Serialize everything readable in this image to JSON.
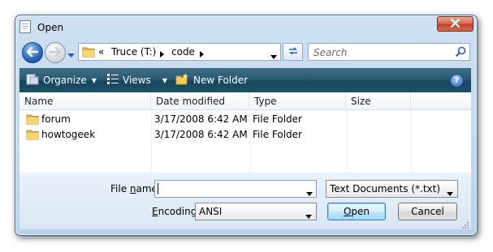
{
  "window": {
    "title": "Open",
    "icon": "open-dialog-icon",
    "close_icon": "close-icon"
  },
  "navigation": {
    "back_icon": "back-arrow-icon",
    "forward_icon": "forward-arrow-icon",
    "history_icon": "chevron-down-icon"
  },
  "address_bar": {
    "prefix": "«",
    "crumbs": [
      "Truce (T:)",
      "code"
    ],
    "separator_icon": "triangle-right-icon"
  },
  "search": {
    "placeholder": "Search"
  },
  "toolbar": {
    "organize": "Organize",
    "views": "Views",
    "new_folder": "New Folder",
    "help_label": "?"
  },
  "columns": [
    "Name",
    "Date modified",
    "Type",
    "Size"
  ],
  "files": [
    {
      "name": "forum",
      "date": "3/17/2008 6:42 AM",
      "type": "File Folder",
      "size": ""
    },
    {
      "name": "howtogeek",
      "date": "3/17/2008 6:42 AM",
      "type": "File Folder",
      "size": ""
    }
  ],
  "form": {
    "file_name_label_pre": "File ",
    "file_name_label_u": "n",
    "file_name_label_post": "ame:",
    "file_name_value": "",
    "file_type": "Text Documents (*.txt)",
    "encoding_label_u": "E",
    "encoding_label_post": "ncoding:",
    "encoding_value": "ANSI",
    "open_u": "O",
    "open_post": "pen",
    "cancel": "Cancel"
  },
  "colors": {
    "toolbar": "#2b5b74",
    "frame": "#c4d9ee",
    "accent": "#3c7fb1"
  }
}
